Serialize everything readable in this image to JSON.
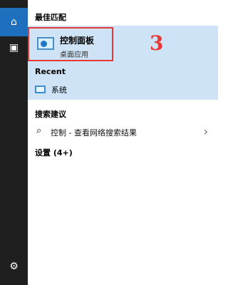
{
  "left_rail": {
    "home_icon": "home-icon",
    "user_icon": "user-icon",
    "settings_icon": "gear-icon"
  },
  "best_match": {
    "title": "最佳匹配",
    "item_title": "控制面板",
    "item_subtitle": "桌面应用",
    "annotation": "3"
  },
  "recent": {
    "title": "Recent",
    "items": [
      {
        "label": "系统"
      }
    ]
  },
  "search_suggestions": {
    "title": "搜索建议",
    "query": "控制",
    "separator": " - ",
    "hint": "查看网络搜索结果"
  },
  "settings": {
    "title": "设置 (4+)"
  }
}
